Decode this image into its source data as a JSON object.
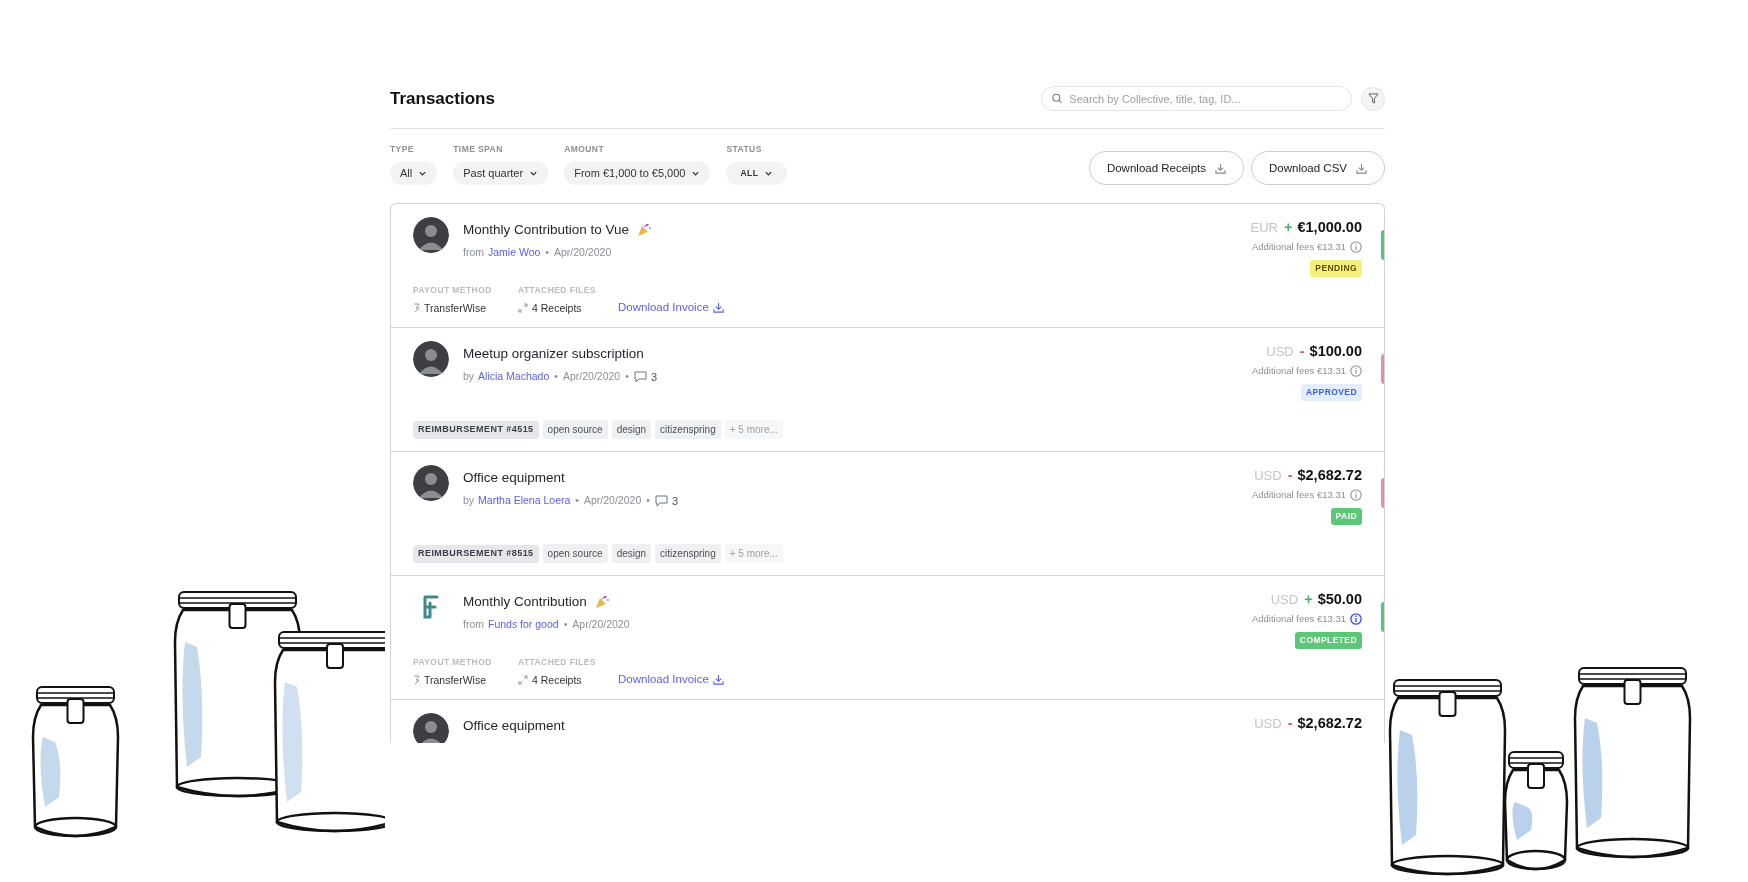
{
  "title": "Transactions",
  "search": {
    "placeholder": "Search by Collective, title, tag, ID..."
  },
  "filters": [
    {
      "label": "TYPE",
      "value": "All",
      "kind": "normal"
    },
    {
      "label": "TIME SPAN",
      "value": "Past quarter",
      "kind": "normal"
    },
    {
      "label": "AMOUNT",
      "value": "From €1,000 to €5,000",
      "kind": "normal"
    },
    {
      "label": "STATUS",
      "value": "ALL",
      "kind": "small"
    }
  ],
  "downloads": [
    "Download Receipts",
    "Download CSV"
  ],
  "transactions": [
    {
      "avatar": {
        "kind": "person"
      },
      "title": "Monthly Contribution to Vue",
      "celebrate": true,
      "prefix": "from",
      "person": "Jamie Woo",
      "separator": "•",
      "date": "Apr/20/2020",
      "currency": "EUR",
      "sign": {
        "text": "+",
        "kind": "credit"
      },
      "amount": "€1,000.00",
      "fees": "Additional fees €13.31",
      "info_active": false,
      "status": {
        "label": "PENDING",
        "kind": "pending"
      },
      "color": "#4cc97a",
      "details": {
        "kind": "payout",
        "payout_label": "PAYOUT METHOD",
        "payout_value": "TransferWise",
        "files_label": "ATTACHED FILES",
        "files_value": "4 Receipts",
        "invoice": "Download Invoice"
      }
    },
    {
      "avatar": {
        "kind": "person"
      },
      "title": "Meetup organizer subscription",
      "celebrate": false,
      "prefix": "by",
      "person": "Alicia Machado",
      "separator": "•",
      "date": "Apr/20/2020",
      "comments": "3",
      "currency": "USD",
      "sign": {
        "text": "-",
        "kind": "debit"
      },
      "amount": "$100.00",
      "fees": "Additional fees €13.31",
      "info_active": false,
      "status": {
        "label": "APPROVED",
        "kind": "approved"
      },
      "color": "#f08aa0",
      "details": {
        "kind": "tags",
        "tags": [
          {
            "label": "REIMBURSEMENT #4515",
            "kind": "primary"
          },
          {
            "label": "open source",
            "kind": "tag"
          },
          {
            "label": "design",
            "kind": "tag"
          },
          {
            "label": "citizenspring",
            "kind": "tag"
          },
          {
            "label": "+ 5 more...",
            "kind": "more"
          }
        ]
      }
    },
    {
      "avatar": {
        "kind": "person"
      },
      "title": "Office equipment",
      "celebrate": false,
      "prefix": "by",
      "person": "Martha Elena Loera",
      "separator": "•",
      "date": "Apr/20/2020",
      "comments": "3",
      "currency": "USD",
      "sign": {
        "text": "-",
        "kind": "debit"
      },
      "amount": "$2,682.72",
      "fees": "Additional fees €13.31",
      "info_active": false,
      "status": {
        "label": "PAID",
        "kind": "paid"
      },
      "color": "#f08aa0",
      "details": {
        "kind": "tags",
        "tags": [
          {
            "label": "REIMBURSEMENT #8515",
            "kind": "primary"
          },
          {
            "label": "open source",
            "kind": "tag"
          },
          {
            "label": "design",
            "kind": "tag"
          },
          {
            "label": "citizenspring",
            "kind": "tag"
          },
          {
            "label": "+ 5 more...",
            "kind": "more"
          }
        ]
      }
    },
    {
      "avatar": {
        "kind": "logo"
      },
      "title": "Monthly Contribution",
      "celebrate": true,
      "prefix": "from",
      "person": "Funds for good",
      "separator": "•",
      "date": "Apr/20/2020",
      "currency": "USD",
      "sign": {
        "text": "+",
        "kind": "credit"
      },
      "amount": "$50.00",
      "fees": "Additional fees €13.31",
      "info_active": true,
      "status": {
        "label": "COMPLETED",
        "kind": "completed"
      },
      "color": "#4cc97a",
      "details": {
        "kind": "payout",
        "payout_label": "PAYOUT METHOD",
        "payout_value": "TransferWise",
        "files_label": "ATTACHED FILES",
        "files_value": "4 Receipts",
        "invoice": "Download Invoice"
      }
    },
    {
      "avatar": {
        "kind": "person"
      },
      "title": "Office equipment",
      "currency": "USD",
      "sign": {
        "text": "-",
        "kind": "debit"
      },
      "amount": "$2,682.72"
    }
  ]
}
